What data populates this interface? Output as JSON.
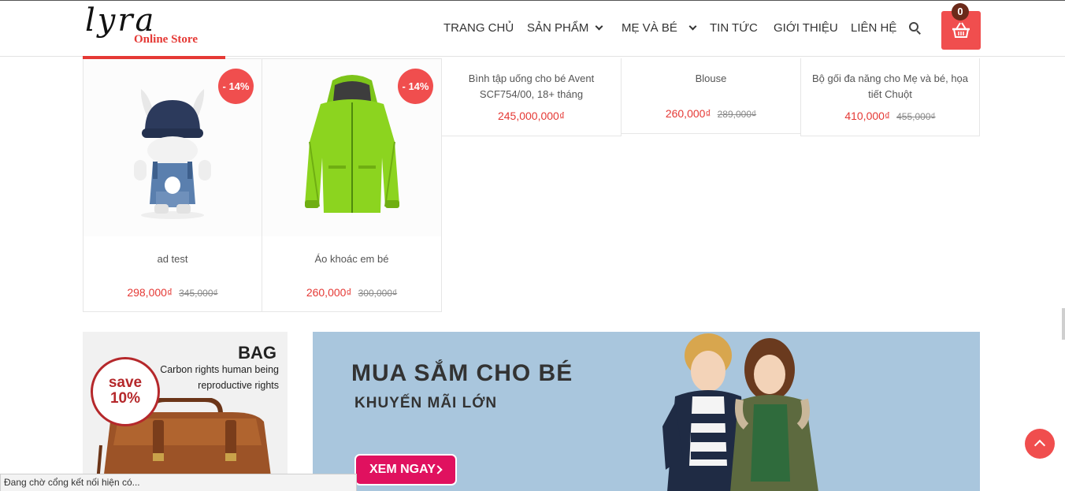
{
  "header": {
    "logo_script": "lyra",
    "logo_sub": "Online Store",
    "nav": [
      {
        "label": "TRANG CHỦ"
      },
      {
        "label": "SẢN PHẨM"
      },
      {
        "label": "MẸ VÀ BÉ"
      },
      {
        "label": "TIN TỨC"
      },
      {
        "label": "GIỚI THIỆU"
      },
      {
        "label": "LIÊN HỆ"
      }
    ],
    "cart_count": "0",
    "brand_color": "#e53935",
    "accent_color": "#f04e4e"
  },
  "products": [
    {
      "name": "ad test",
      "price": "298,000₫",
      "old_price": "345,000₫",
      "discount": "- 14%",
      "image_icon": "hat-bunny-toy"
    },
    {
      "name": "Áo khoác em bé",
      "price": "260,000₫",
      "old_price": "300,000₫",
      "discount": "- 14%",
      "image_icon": "green-jacket"
    },
    {
      "name": "Bình tập uống cho bé Avent SCF754/00, 18+ tháng",
      "price": "245,000,000₫",
      "old_price": ""
    },
    {
      "name": "Blouse",
      "price": "260,000₫",
      "old_price": "289,000₫"
    },
    {
      "name": "Bộ gối đa năng cho Mẹ và bé, họa tiết Chuột",
      "price": "410,000₫",
      "old_price": "455,000₫"
    }
  ],
  "promo_bag": {
    "title": "BAG",
    "subtitle": "Carbon rights human being reproductive rights",
    "save_line1": "save",
    "save_line2": "10%"
  },
  "promo_kids": {
    "title": "MUA SẮM CHO BÉ",
    "subtitle": "KHUYẾN MÃI LỚN",
    "button": "XEM NGAY"
  },
  "status_text": "Đang chờ cổng kết nối hiện có..."
}
